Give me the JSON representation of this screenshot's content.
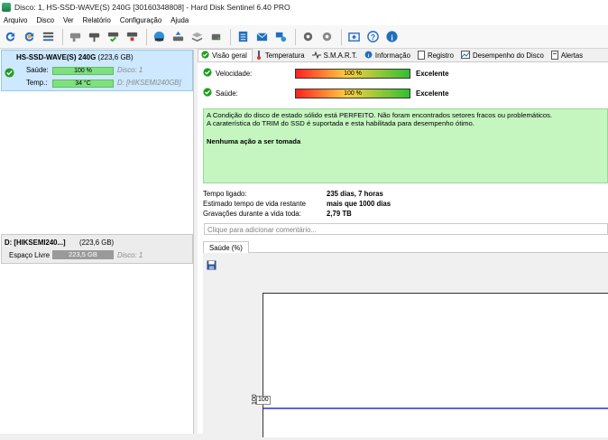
{
  "window": {
    "title": "Disco: 1, HS-SSD-WAVE(S) 240G [30160348808]  -  Hard Disk Sentinel 6.40 PRO"
  },
  "menu": [
    {
      "label": "Arquivo"
    },
    {
      "label": "Disco"
    },
    {
      "label": "Ver"
    },
    {
      "label": "Relatório"
    },
    {
      "label": "Configuração"
    },
    {
      "label": "Ajuda"
    }
  ],
  "toolbar_icons": [
    "refresh-icon",
    "refresh-all-icon",
    "drive-list-icon",
    "disk-gray-icon",
    "disk-test-icon",
    "disk-check-icon",
    "disk-erase-icon",
    "globe-icon",
    "disk-upload-icon",
    "disk-stack-icon",
    "disk-small-icon",
    "report-icon",
    "mail-icon",
    "network-icon",
    "settings-icon",
    "gear-icon",
    "screenshot-icon",
    "help-icon",
    "info-icon"
  ],
  "left_panel": {
    "disk": {
      "name": "HS-SSD-WAVE(S) 240G",
      "size": "(223,6 GB)",
      "health_label": "Saúde:",
      "health_value": "100 %",
      "health_pct": 100,
      "temp_label": "Temp.:",
      "temp_value": "34 °C",
      "disk_no": "Disco: 1",
      "drive_path": "D: [HIKSEMI240GB]"
    },
    "volume": {
      "name": "D: [HIKSEMI240...]",
      "size": "(223,6 GB)",
      "free_label": "Espaço Livre",
      "free_value": "223,5 GB",
      "disk_no": "Disco: 1"
    }
  },
  "tabs": [
    {
      "label": "Visão geral",
      "icon": "check-icon"
    },
    {
      "label": "Temperatura",
      "icon": "thermometer-icon"
    },
    {
      "label": "S.M.A.R.T.",
      "icon": "smart-icon"
    },
    {
      "label": "Informação",
      "icon": "info-icon"
    },
    {
      "label": "Registro",
      "icon": "log-icon"
    },
    {
      "label": "Desempenho do Disco",
      "icon": "performance-icon"
    },
    {
      "label": "Alertas",
      "icon": "alert-icon"
    }
  ],
  "overview": {
    "speed": {
      "label": "Velocidade:",
      "value": "100 %",
      "pct": 100,
      "rating": "Excelente"
    },
    "health": {
      "label": "Saúde:",
      "value": "100 %",
      "pct": 100,
      "rating": "Excelente"
    },
    "status_lines": [
      "A Condição do disco de estado sólido está PERFEITO. Não foram encontrados setores fracos ou problemáticos.",
      "A caraterística do TRIM do SSD é suportada e esta habilitada para desempenho ótimo."
    ],
    "action": "Nenhuma ação a ser tomada",
    "info": [
      {
        "label": "Tempo ligado:",
        "value": "235 dias, 7 horas"
      },
      {
        "label": "Estimado tempo de vida restante",
        "value": "mais que 1000 dias"
      },
      {
        "label": "Gravações durante a vida toda:",
        "value": "2,79 TB"
      }
    ],
    "comment_placeholder": "Clique para adicionar  comentário..."
  },
  "chart_tab": {
    "label": "Saúde (%)"
  },
  "chart_data": {
    "type": "line",
    "title": "",
    "xlabel": "",
    "ylabel": "",
    "series": [
      {
        "values": [
          100
        ]
      }
    ],
    "tick_labels": [
      "100"
    ],
    "point_label": "100",
    "line_color": "#2b2bd6"
  }
}
